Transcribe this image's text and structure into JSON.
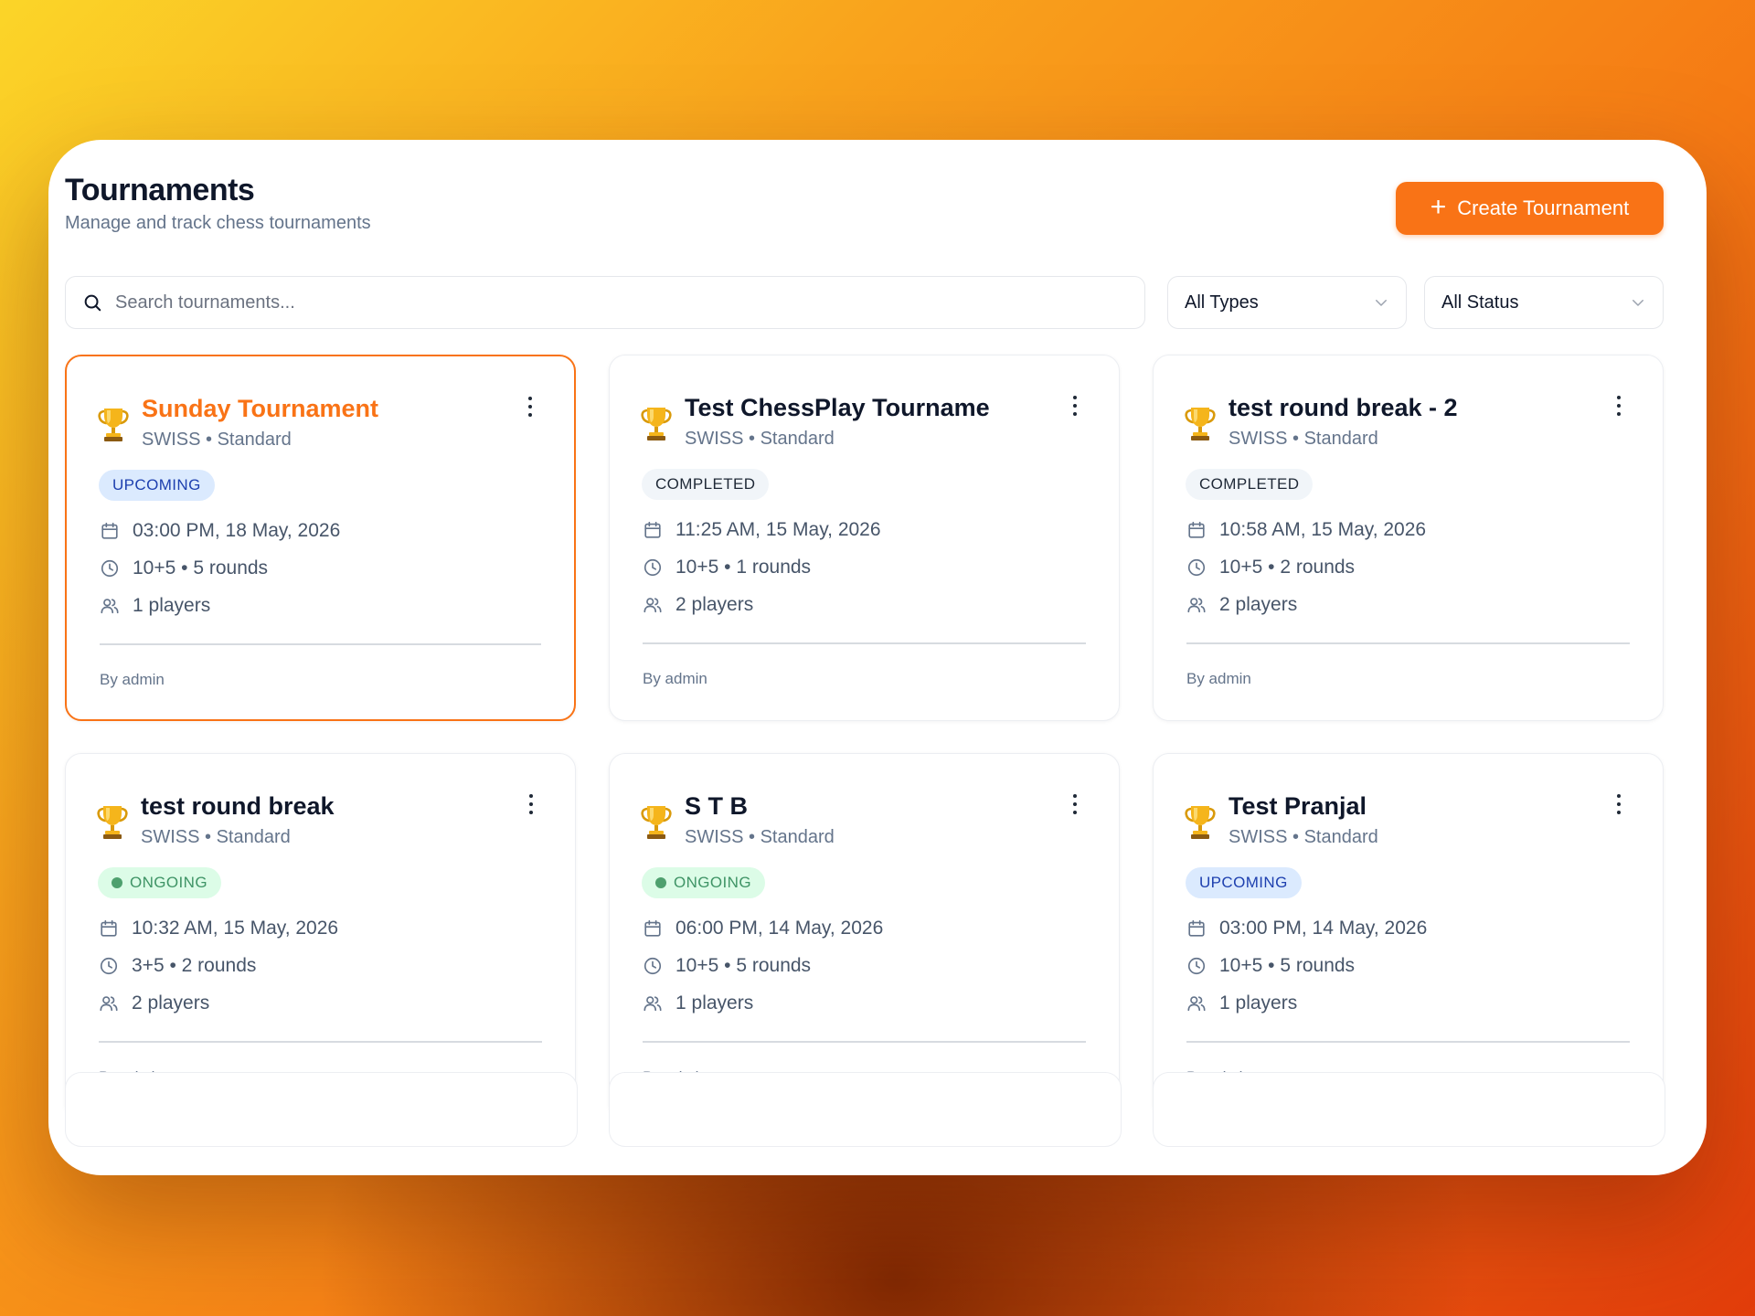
{
  "header": {
    "title": "Tournaments",
    "subtitle": "Manage and track chess tournaments",
    "create_label": "Create Tournament"
  },
  "filters": {
    "search_placeholder": "Search tournaments...",
    "type_selected": "All Types",
    "status_selected": "All Status"
  },
  "tournaments": [
    {
      "name": "Sunday Tournament",
      "meta": "SWISS • Standard",
      "status": "UPCOMING",
      "date": "03:00 PM, 18 May, 2026",
      "time_control": "10+5 • 5 rounds",
      "players": "1 players",
      "by": "By admin"
    },
    {
      "name": "Test ChessPlay Tourname",
      "meta": "SWISS • Standard",
      "status": "COMPLETED",
      "date": "11:25 AM, 15 May, 2026",
      "time_control": "10+5 • 1 rounds",
      "players": "2 players",
      "by": "By admin"
    },
    {
      "name": "test round break - 2",
      "meta": "SWISS • Standard",
      "status": "COMPLETED",
      "date": "10:58 AM, 15 May, 2026",
      "time_control": "10+5 • 2 rounds",
      "players": "2 players",
      "by": "By admin"
    },
    {
      "name": "test round break",
      "meta": "SWISS • Standard",
      "status": "ONGOING",
      "date": "10:32 AM, 15 May, 2026",
      "time_control": "3+5 • 2 rounds",
      "players": "2 players",
      "by": "By admin"
    },
    {
      "name": "S T B",
      "meta": "SWISS • Standard",
      "status": "ONGOING",
      "date": "06:00 PM, 14 May, 2026",
      "time_control": "10+5 • 5 rounds",
      "players": "1 players",
      "by": "By admin"
    },
    {
      "name": "Test Pranjal",
      "meta": "SWISS • Standard",
      "status": "UPCOMING",
      "date": "03:00 PM, 14 May, 2026",
      "time_control": "10+5 • 5 rounds",
      "players": "1 players",
      "by": "By admin"
    }
  ],
  "colors": {
    "accent": "#f97316",
    "upcoming_bg": "#dbeafe",
    "completed_bg": "#f1f5f9",
    "ongoing_bg": "#dcfce7"
  },
  "icons": [
    "search-icon",
    "chevron-down-icon",
    "plus-icon",
    "trophy-icon",
    "calendar-icon",
    "clock-icon",
    "users-icon",
    "more-vertical-icon"
  ]
}
